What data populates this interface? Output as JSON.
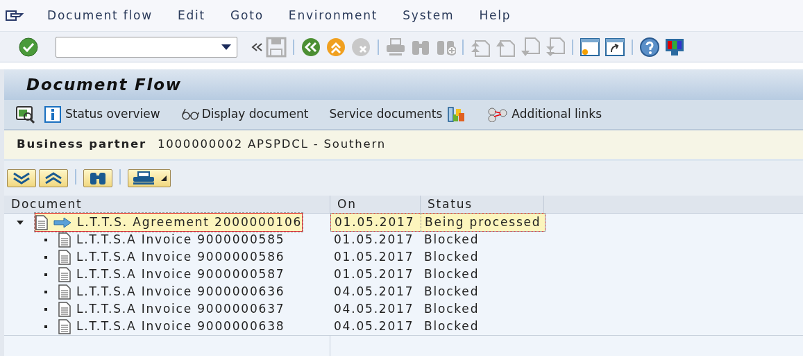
{
  "menu": [
    {
      "label": "Document flow"
    },
    {
      "label": "Edit"
    },
    {
      "label": "Goto"
    },
    {
      "label": "Environment"
    },
    {
      "label": "System"
    },
    {
      "label": "Help"
    }
  ],
  "title": "Document Flow",
  "app_toolbar": [
    {
      "label": "Status overview"
    },
    {
      "label": "Display document"
    },
    {
      "label": "Service documents"
    },
    {
      "label": "Additional links"
    }
  ],
  "header": {
    "label": "Business partner",
    "value": "1000000002 APSPDCL - Southern"
  },
  "table": {
    "columns": [
      "Document",
      "On",
      "Status"
    ],
    "rows": [
      {
        "document": "L.T.T.S. Agreement 2000000106",
        "on": "01.05.2017",
        "status": "Being processed",
        "selected": true,
        "expanded": true,
        "children": [
          {
            "document": "L.T.T.S.A Invoice 9000000585",
            "on": "01.05.2017",
            "status": "Blocked",
            "selected": false
          },
          {
            "document": "L.T.T.S.A Invoice 9000000586",
            "on": "01.05.2017",
            "status": "Blocked",
            "selected": false
          },
          {
            "document": "L.T.T.S.A Invoice 9000000587",
            "on": "01.05.2017",
            "status": "Blocked",
            "selected": false
          },
          {
            "document": "L.T.T.S.A Invoice 9000000636",
            "on": "04.05.2017",
            "status": "Blocked",
            "selected": false
          },
          {
            "document": "L.T.T.S.A Invoice 9000000637",
            "on": "04.05.2017",
            "status": "Blocked",
            "selected": false
          },
          {
            "document": "L.T.T.S.A Invoice 9000000638",
            "on": "04.05.2017",
            "status": "Blocked",
            "selected": false
          }
        ]
      }
    ]
  }
}
